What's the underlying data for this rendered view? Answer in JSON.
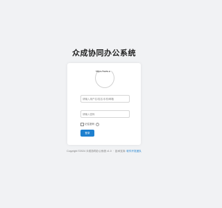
{
  "app": {
    "title": "众成协同办公系统"
  },
  "login": {
    "qr_url": "https://www.a",
    "username_placeholder": "请输入用户名/姓名/手机/邮箱",
    "password_placeholder": "请输入密码",
    "remember_label": "记住密码",
    "help_icon": "?",
    "login_button": "登录"
  },
  "footer": {
    "copyright": "Copyright ©2024 众成协同办公系统 v1.0",
    "separator": "·",
    "support_label": "技术支持:",
    "support_link": "软件开发团队"
  }
}
